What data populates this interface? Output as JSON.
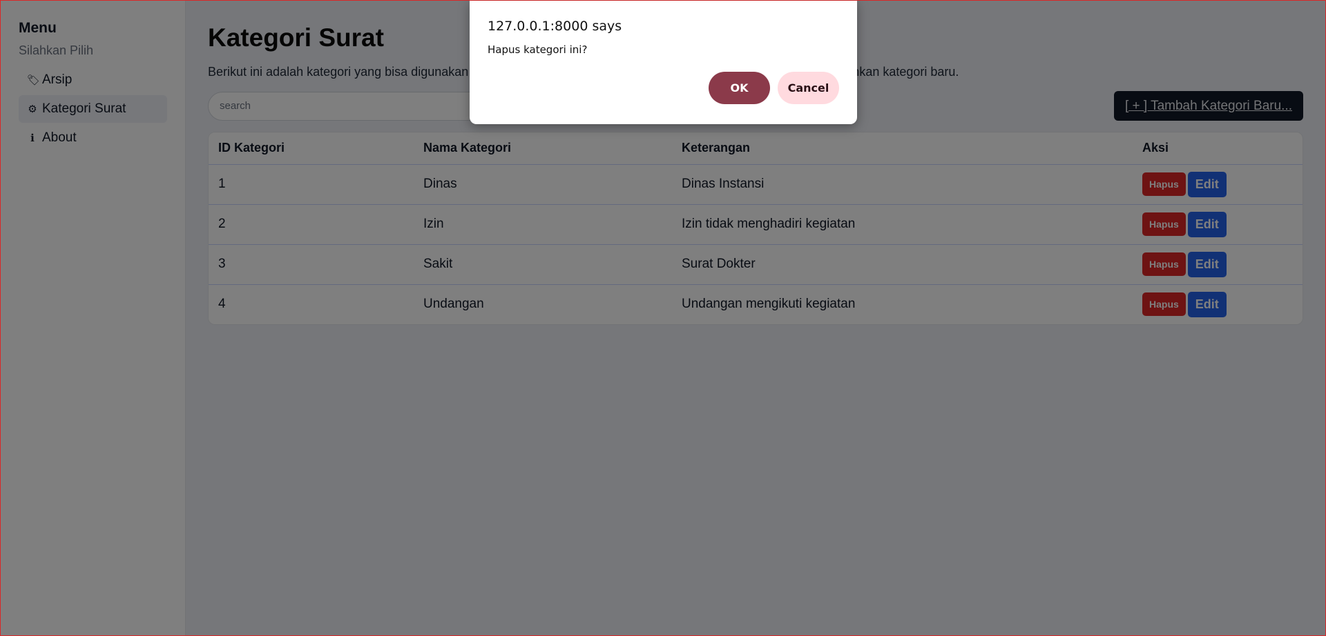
{
  "sidebar": {
    "title": "Menu",
    "subtitle": "Silahkan Pilih",
    "items": [
      {
        "icon": "🏷",
        "label": "Arsip",
        "active": false
      },
      {
        "icon": "⚙",
        "label": "Kategori Surat",
        "active": true
      },
      {
        "icon": "ℹ",
        "label": "About",
        "active": false
      }
    ]
  },
  "main": {
    "title": "Kategori Surat",
    "description": "Berikut ini adalah kategori yang bisa digunakan untuk melabeli surat. Klik \"Tambah\" pada kolom aksi untuk menambahkan kategori baru.",
    "search_placeholder": "search",
    "add_button": "[ + ] Tambah Kategori Baru..."
  },
  "table": {
    "headers": [
      "ID Kategori",
      "Nama Kategori",
      "Keterangan",
      "Aksi"
    ],
    "rows": [
      {
        "id": "1",
        "nama": "Dinas",
        "keterangan": "Dinas Instansi"
      },
      {
        "id": "2",
        "nama": "Izin",
        "keterangan": "Izin tidak menghadiri kegiatan"
      },
      {
        "id": "3",
        "nama": "Sakit",
        "keterangan": "Surat Dokter"
      },
      {
        "id": "4",
        "nama": "Undangan",
        "keterangan": "Undangan mengikuti kegiatan"
      }
    ],
    "delete_label": "Hapus",
    "edit_label": "Edit"
  },
  "dialog": {
    "title": "127.0.0.1:8000 says",
    "message": "Hapus kategori ini?",
    "ok_label": "OK",
    "cancel_label": "Cancel"
  },
  "colors": {
    "delete": "#dc2626",
    "edit": "#2563eb",
    "ok": "#8b3a4a",
    "cancel": "#ffdadf"
  }
}
